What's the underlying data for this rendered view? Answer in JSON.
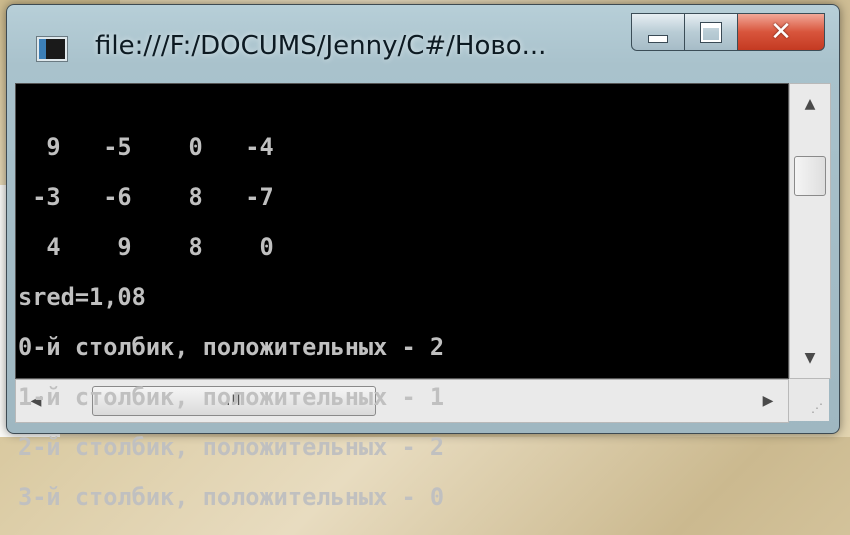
{
  "window": {
    "title": "file:///F:/DOCUMS/Jenny/C#/Ново...",
    "icon": "console-app-icon",
    "controls": {
      "minimize": "minimize-icon",
      "maximize": "maximize-icon",
      "close": "✕"
    }
  },
  "console": {
    "lines": [
      "  9   -5    0   -4",
      " -3   -6    8   -7",
      "  4    9    8    0",
      "sred=1,08",
      "0-й столбик, положительных - 2",
      "1-й столбик, положительных - 1",
      "2-й столбик, положительных - 2",
      "3-й столбик, положительных - 0"
    ]
  },
  "scrollbars": {
    "vertical": {
      "up_arrow": "▲",
      "down_arrow": "▼"
    },
    "horizontal": {
      "left_arrow": "◀",
      "right_arrow": "▶",
      "thumb_grip": "III"
    }
  },
  "colors": {
    "console_background": "#000000",
    "console_text": "#c0c0c0",
    "close_button": "#c43a22"
  }
}
